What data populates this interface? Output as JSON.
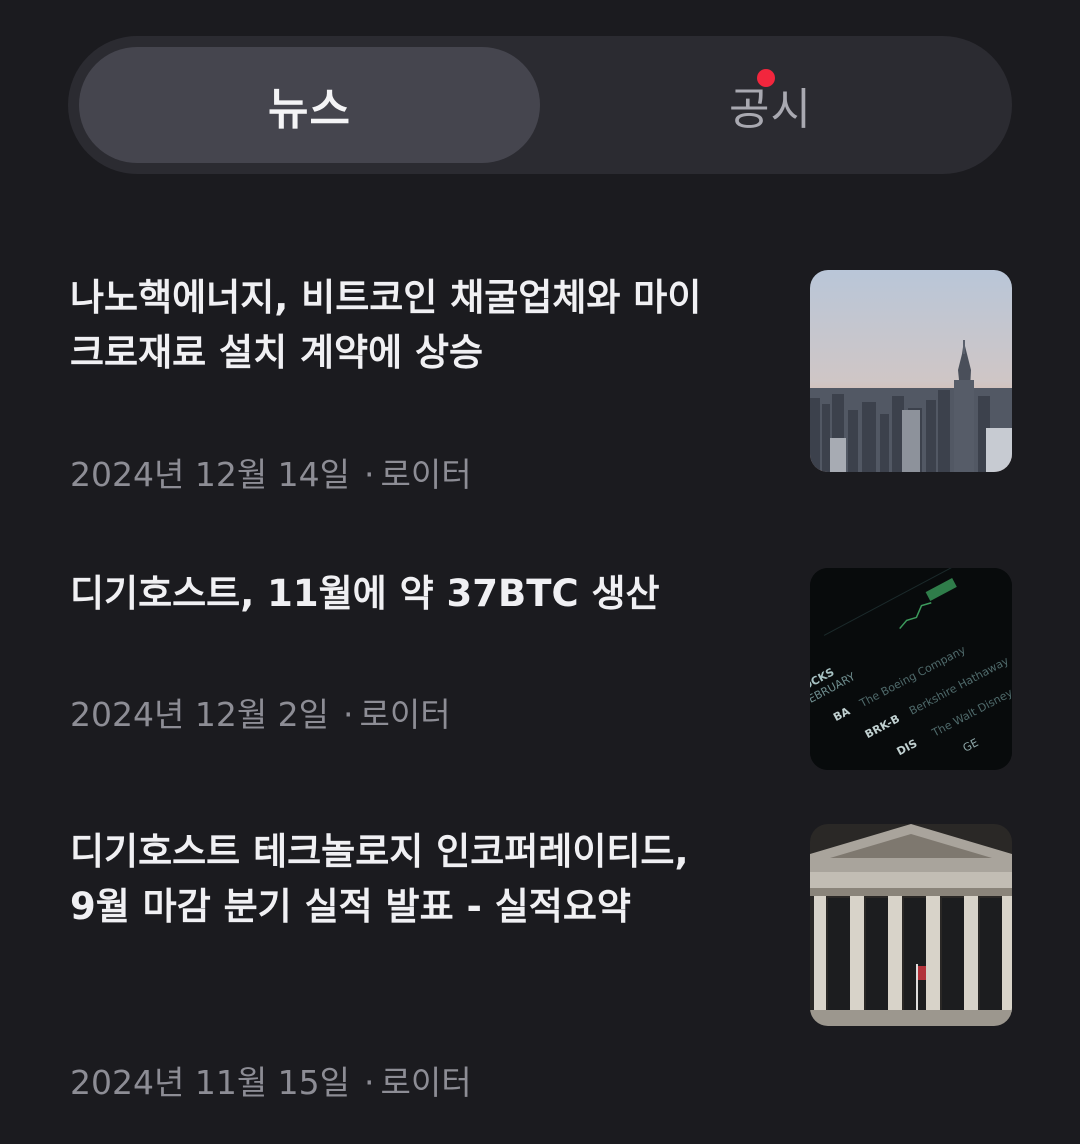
{
  "tabs": {
    "news_label": "뉴스",
    "disclosure_label": "공시",
    "disclosure_has_new": true
  },
  "articles": [
    {
      "title": "나노핵에너지, 비트코인 채굴업체와 마이크로재료 설치 계약에 상승",
      "date": "2024년 12월 14일",
      "separator": "·",
      "source": "로이터",
      "thumbnail": "city-skyline-image"
    },
    {
      "title": "디기호스트, 11월에 약 37BTC 생산",
      "date": "2024년 12월 2일",
      "separator": "·",
      "source": "로이터",
      "thumbnail": "stock-ticker-screen-image"
    },
    {
      "title": "디기호스트 테크놀로지 인코퍼레이티드, 9월 마감 분기 실적 발표 - 실적요약",
      "date": "2024년 11월 15일",
      "separator": "·",
      "source": "로이터",
      "thumbnail": "stock-exchange-building-image"
    }
  ],
  "colors": {
    "background": "#1b1b1f",
    "segment_bg": "#2b2b31",
    "segment_active": "#45454e",
    "notification_dot": "#f2263d",
    "meta_text": "#8d8d95"
  }
}
